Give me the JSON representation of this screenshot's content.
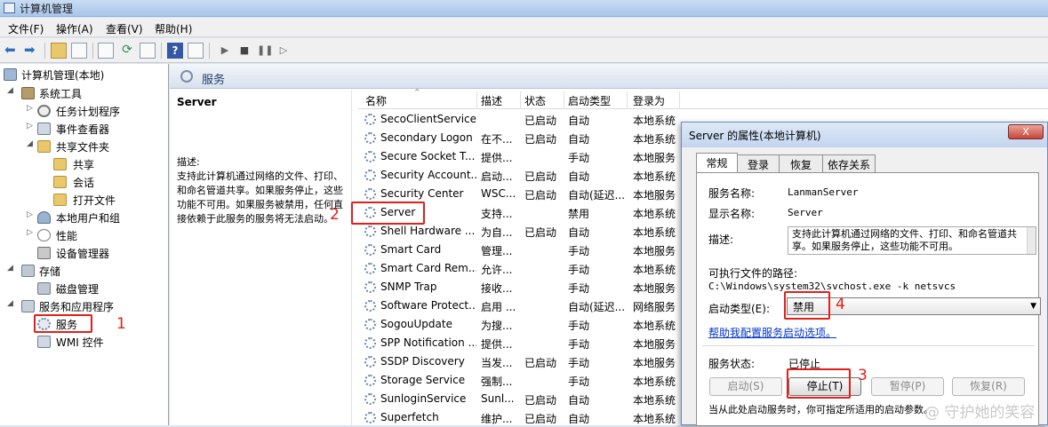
{
  "window": {
    "title": "计算机管理"
  },
  "menu": [
    "文件(F)",
    "操作(A)",
    "查看(V)",
    "帮助(H)"
  ],
  "tree": [
    {
      "label": "计算机管理(本地)"
    },
    {
      "label": "系统工具"
    },
    {
      "label": "任务计划程序"
    },
    {
      "label": "事件查看器"
    },
    {
      "label": "共享文件夹"
    },
    {
      "label": "共享"
    },
    {
      "label": "会话"
    },
    {
      "label": "打开文件"
    },
    {
      "label": "本地用户和组"
    },
    {
      "label": "性能"
    },
    {
      "label": "设备管理器"
    },
    {
      "label": "存储"
    },
    {
      "label": "磁盘管理"
    },
    {
      "label": "服务和应用程序"
    },
    {
      "label": "服务"
    },
    {
      "label": "WMI 控件"
    }
  ],
  "services_pane": {
    "header": "服务",
    "selected_name": "Server",
    "desc_label": "描述:",
    "desc_text": "支持此计算机通过网络的文件、打印、和命名管道共享。如果服务停止，这些功能不可用。如果服务被禁用，任何直接依赖于此服务的服务将无法启动。"
  },
  "columns": [
    "名称",
    "描述",
    "状态",
    "启动类型",
    "登录为"
  ],
  "rows": [
    {
      "name": "SecoClientService",
      "desc": "",
      "status": "已启动",
      "start": "自动",
      "logon": "本地系统"
    },
    {
      "name": "Secondary Logon",
      "desc": "在不...",
      "status": "已启动",
      "start": "自动",
      "logon": "本地系统"
    },
    {
      "name": "Secure Socket T...",
      "desc": "提供...",
      "status": "",
      "start": "手动",
      "logon": "本地服务"
    },
    {
      "name": "Security Account...",
      "desc": "启动...",
      "status": "已启动",
      "start": "自动",
      "logon": "本地系统"
    },
    {
      "name": "Security Center",
      "desc": "WSC...",
      "status": "已启动",
      "start": "自动(延迟...",
      "logon": "本地服务"
    },
    {
      "name": "Server",
      "desc": "支持...",
      "status": "",
      "start": "禁用",
      "logon": "本地系统"
    },
    {
      "name": "Shell Hardware ...",
      "desc": "为自...",
      "status": "已启动",
      "start": "自动",
      "logon": "本地系统"
    },
    {
      "name": "Smart Card",
      "desc": "管理...",
      "status": "",
      "start": "手动",
      "logon": "本地服务"
    },
    {
      "name": "Smart Card Rem...",
      "desc": "允许...",
      "status": "",
      "start": "手动",
      "logon": "本地系统"
    },
    {
      "name": "SNMP Trap",
      "desc": "接收...",
      "status": "",
      "start": "手动",
      "logon": "本地服务"
    },
    {
      "name": "Software Protect...",
      "desc": "启用 ...",
      "status": "",
      "start": "自动(延迟...",
      "logon": "网络服务"
    },
    {
      "name": "SogouUpdate",
      "desc": "为搜...",
      "status": "",
      "start": "手动",
      "logon": "本地系统"
    },
    {
      "name": "SPP Notification ...",
      "desc": "提供...",
      "status": "",
      "start": "手动",
      "logon": "本地服务"
    },
    {
      "name": "SSDP Discovery",
      "desc": "当发...",
      "status": "已启动",
      "start": "手动",
      "logon": "本地服务"
    },
    {
      "name": "Storage Service",
      "desc": "强制...",
      "status": "",
      "start": "手动",
      "logon": "本地系统"
    },
    {
      "name": "SunloginService",
      "desc": "Sunl...",
      "status": "已启动",
      "start": "自动",
      "logon": "本地系统"
    },
    {
      "name": "Superfetch",
      "desc": "维护...",
      "status": "已启动",
      "start": "自动",
      "logon": "本地系统"
    }
  ],
  "dialog": {
    "title": "Server 的属性(本地计算机)",
    "close": "X",
    "tabs": [
      "常规",
      "登录",
      "恢复",
      "依存关系"
    ],
    "service_name_label": "服务名称:",
    "service_name": "LanmanServer",
    "display_name_label": "显示名称:",
    "display_name": "Server",
    "desc_label": "描述:",
    "desc": "支持此计算机通过网络的文件、打印、和命名管道共享。如果服务停止，这些功能不可用。",
    "path_label": "可执行文件的路径:",
    "path": "C:\\Windows\\system32\\svchost.exe -k netsvcs",
    "startup_label": "启动类型(E):",
    "startup_value": "禁用",
    "help_link": "帮助我配置服务启动选项。",
    "status_label": "服务状态:",
    "status_value": "已停止",
    "buttons": [
      "启动(S)",
      "停止(T)",
      "暂停(P)",
      "恢复(R)"
    ],
    "footer": "当从此处启动服务时，你可指定所适用的启动参数。"
  },
  "annotations": [
    "1",
    "2",
    "3",
    "4"
  ],
  "watermark": "@ 守护她的笑容"
}
